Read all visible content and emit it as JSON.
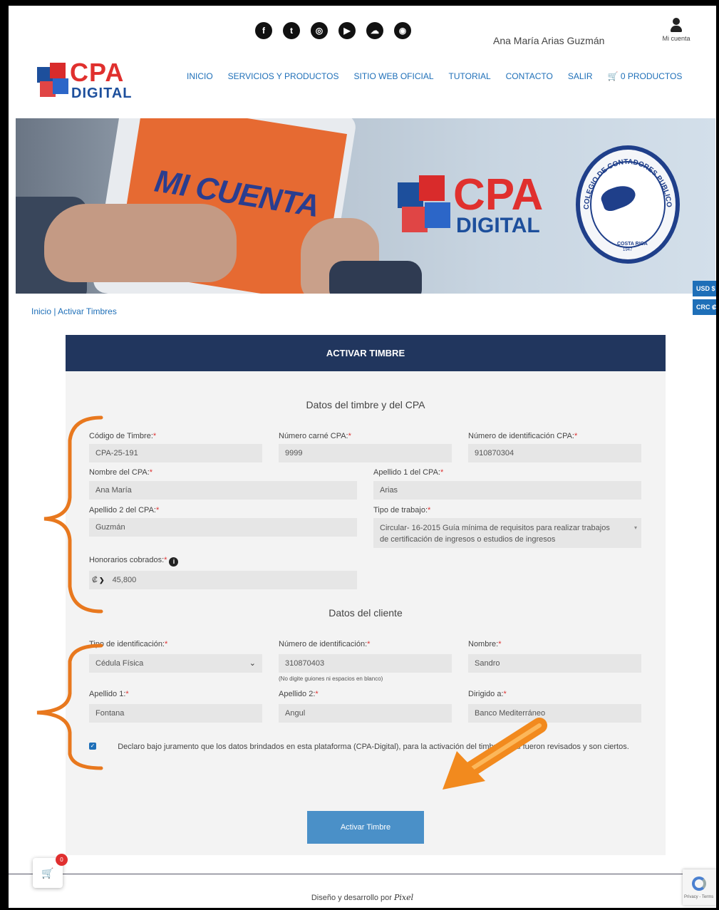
{
  "header": {
    "social": [
      {
        "icon": "facebook-icon",
        "glyph": "f"
      },
      {
        "icon": "tumblr-icon",
        "glyph": "t"
      },
      {
        "icon": "instagram-icon",
        "glyph": "◎"
      },
      {
        "icon": "youtube-icon",
        "glyph": "▶"
      },
      {
        "icon": "soundcloud-icon",
        "glyph": "☁"
      },
      {
        "icon": "podcast-icon",
        "glyph": "◉"
      }
    ],
    "user_name": "Ana María Arias Guzmán",
    "account_label": "Mi cuenta",
    "logo_top": "CPA",
    "logo_bottom": "DIGITAL",
    "nav": [
      "INICIO",
      "SERVICIOS Y PRODUCTOS",
      "SITIO WEB OFICIAL",
      "TUTORIAL",
      "CONTACTO",
      "SALIR"
    ],
    "cart_label": "0 PRODUCTOS"
  },
  "banner": {
    "tablet_text": "MI CUENTA",
    "logo_top": "CPA",
    "logo_bottom": "DIGITAL",
    "seal_text": "COLEGIO DE CONTADORES PUBLICOS",
    "seal_country": "COSTA RICA",
    "seal_year": "1947"
  },
  "currency": {
    "usd": "USD $",
    "crc": "CRC ₡"
  },
  "breadcrumb": "Inicio | Activar Timbres",
  "form": {
    "title": "ACTIVAR TIMBRE",
    "section1": "Datos del timbre y del CPA",
    "section2": "Datos del cliente",
    "codigo_label": "Código de Timbre:",
    "codigo_value": "CPA-25-191",
    "carne_label": "Número carné CPA:",
    "carne_value": "9999",
    "idcpa_label": "Número de identificación CPA:",
    "idcpa_value": "910870304",
    "nombre_label": "Nombre del CPA:",
    "nombre_value": "Ana María",
    "ap1_label": "Apellido 1 del CPA:",
    "ap1_value": "Arias",
    "ap2_label": "Apellido 2 del CPA:",
    "ap2_value": "Guzmán",
    "tipo_label": "Tipo de trabajo:",
    "tipo_value_line1": "Circular- 16-2015 Guía mínima de requisitos para realizar trabajos",
    "tipo_value_line2": "de certificación de ingresos o estudios de ingresos",
    "hon_label": "Honorarios cobrados:",
    "hon_currency": "₡",
    "hon_value": "45,800",
    "tipoid_label": "Tipo de identificación:",
    "tipoid_value": "Cédula Física",
    "numid_label": "Número de identificación:",
    "numid_value": "310870403",
    "numid_hint": "(No digite guiones ni espacios en blanco)",
    "nom_label": "Nombre:",
    "nom_value": "Sandro",
    "cap1_label": "Apellido 1:",
    "cap1_value": "Fontana",
    "cap2_label": "Apellido 2:",
    "cap2_value": "Angul",
    "dirigido_label": "Dirigido a:",
    "dirigido_value": "Banco Mediterráneo",
    "declaration": "Declaro bajo juramento que los datos brindados en esta plataforma (CPA-Digital), para la activación del timbre fiscal fueron revisados y son ciertos.",
    "submit": "Activar Timbre"
  },
  "footer": {
    "text": "Diseño y desarrollo por",
    "brand": "Pixel"
  },
  "floating": {
    "cart_count": "0",
    "recaptcha": "Privacy - Terms"
  },
  "colors": {
    "nav": "#1e6fb8",
    "panel_head": "#21365e",
    "button": "#4a90c8",
    "annotation": "#e8781e"
  }
}
